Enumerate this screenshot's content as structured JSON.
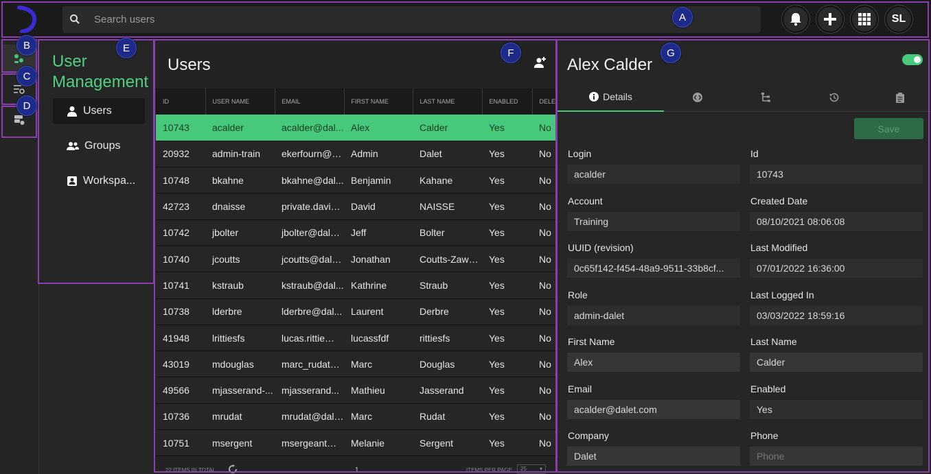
{
  "topbar": {
    "search_placeholder": "Search users",
    "avatar_initials": "SL",
    "icons": [
      "bell-icon",
      "plus-icon",
      "grid-icon"
    ]
  },
  "callouts": [
    "A",
    "B",
    "C",
    "D",
    "E",
    "F",
    "G"
  ],
  "nav": {
    "title_line1": "User",
    "title_line2": "Management",
    "items": [
      {
        "label": "Users",
        "icon": "user-icon"
      },
      {
        "label": "Groups",
        "icon": "group-icon"
      },
      {
        "label": "Workspa...",
        "icon": "workspace-icon"
      }
    ]
  },
  "list": {
    "title": "Users",
    "columns": [
      "ID",
      "USER NAME",
      "EMAIL",
      "FIRST NAME",
      "LAST NAME",
      "ENABLED",
      "DELE"
    ],
    "rows": [
      [
        "10743",
        "acalder",
        "acalder@dal...",
        "Alex",
        "Calder",
        "Yes",
        "No"
      ],
      [
        "20932",
        "admin-train",
        "ekerfourn@d...",
        "Admin",
        "Dalet",
        "Yes",
        "No"
      ],
      [
        "10748",
        "bkahne",
        "bkahne@dal...",
        "Benjamin",
        "Kahane",
        "Yes",
        "No"
      ],
      [
        "42723",
        "dnaisse",
        "private.david...",
        "David",
        "NAISSE",
        "Yes",
        "No"
      ],
      [
        "10742",
        "jbolter",
        "jbolter@dalet...",
        "Jeff",
        "Bolter",
        "Yes",
        "No"
      ],
      [
        "10740",
        "jcoutts",
        "jcoutts@dale...",
        "Jonathan",
        "Coutts-Zawa...",
        "Yes",
        "No"
      ],
      [
        "10741",
        "kstraub",
        "kstraub@dal...",
        "Kathrine",
        "Straub",
        "Yes",
        "No"
      ],
      [
        "10738",
        "lderbre",
        "lderbre@dal...",
        "Laurent",
        "Derbre",
        "Yes",
        "No"
      ],
      [
        "41948",
        "lrittiesfs",
        "lucas.rittie@g...",
        "lucassfdf",
        "rittiesfs",
        "Yes",
        "No"
      ],
      [
        "43019",
        "mdouglas",
        "marc_rudat@...",
        "Marc",
        "Douglas",
        "Yes",
        "No"
      ],
      [
        "49566",
        "mjasserand-...",
        "mjasserand...",
        "Mathieu",
        "Jasserand",
        "Yes",
        "No"
      ],
      [
        "10736",
        "mrudat",
        "mrudat@dale...",
        "Marc",
        "Rudat",
        "Yes",
        "No"
      ],
      [
        "10751",
        "msergent",
        "msergeant@...",
        "Melanie",
        "Sergent",
        "Yes",
        "No"
      ]
    ],
    "selected_index": 0,
    "footer_total": "22 ITEMS IN TOTAL",
    "footer_page": "1",
    "footer_per_page_label": "ITEMS PER PAGE",
    "footer_per_page": "25"
  },
  "detail": {
    "title": "Alex Calder",
    "enabled_toggle": true,
    "tabs": [
      {
        "label": "Details",
        "icon": "info-icon"
      },
      {
        "label": "",
        "icon": "code-icon"
      },
      {
        "label": "",
        "icon": "hierarchy-icon"
      },
      {
        "label": "",
        "icon": "history-icon"
      },
      {
        "label": "",
        "icon": "clipboard-icon"
      }
    ],
    "save_label": "Save",
    "fields_left": [
      {
        "label": "Login",
        "value": "acalder"
      },
      {
        "label": "Account",
        "value": "Training"
      },
      {
        "label": "UUID (revision)",
        "value": "0c65f142-f454-48a9-9511-33b8cf..."
      },
      {
        "label": "Role",
        "value": "admin-dalet"
      },
      {
        "label": "First Name",
        "value": "Alex"
      },
      {
        "label": "Email",
        "value": "acalder@dalet.com"
      },
      {
        "label": "Company",
        "value": "Dalet"
      }
    ],
    "fields_right": [
      {
        "label": "Id",
        "value": "10743"
      },
      {
        "label": "Created Date",
        "value": "08/10/2021 08:06:08"
      },
      {
        "label": "Last Modified",
        "value": "07/01/2022 16:36:00"
      },
      {
        "label": "Last Logged In",
        "value": "03/03/2022 18:59:16"
      },
      {
        "label": "Last Name",
        "value": "Calder"
      },
      {
        "label": "Enabled",
        "value": "Yes"
      },
      {
        "label": "Phone",
        "value": "",
        "placeholder": "Phone"
      }
    ]
  }
}
